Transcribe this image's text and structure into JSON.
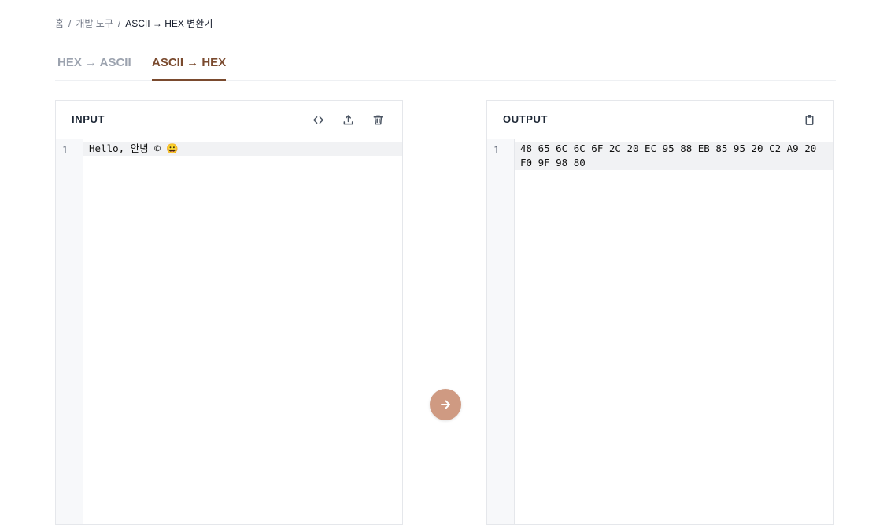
{
  "breadcrumb": {
    "home": "홈",
    "separator": "/",
    "section": "개발 도구",
    "current": "ASCII → HEX 변환기"
  },
  "tabs": [
    {
      "label": "HEX → ASCII",
      "active": false
    },
    {
      "label": "ASCII → HEX",
      "active": true
    }
  ],
  "input_panel": {
    "title": "INPUT",
    "actions": [
      "code-icon",
      "upload-icon",
      "trash-icon"
    ],
    "line_number": "1",
    "value": "Hello, 안녕 © 😀"
  },
  "output_panel": {
    "title": "OUTPUT",
    "actions": [
      "clipboard-icon"
    ],
    "line_number": "1",
    "value": "48 65 6C 6C 6F 2C 20 EC 95 88 EB 85 95 20 C2 A9 20 F0 9F 98 80"
  },
  "convert_button": {
    "icon": "arrow-right-icon"
  },
  "colors": {
    "accent": "#7a4a2e",
    "convert_button": "#cf9a82",
    "inactive_tab": "#9ca3af",
    "gutter": "#f7f8fa",
    "active_line": "#f1f2f4"
  }
}
